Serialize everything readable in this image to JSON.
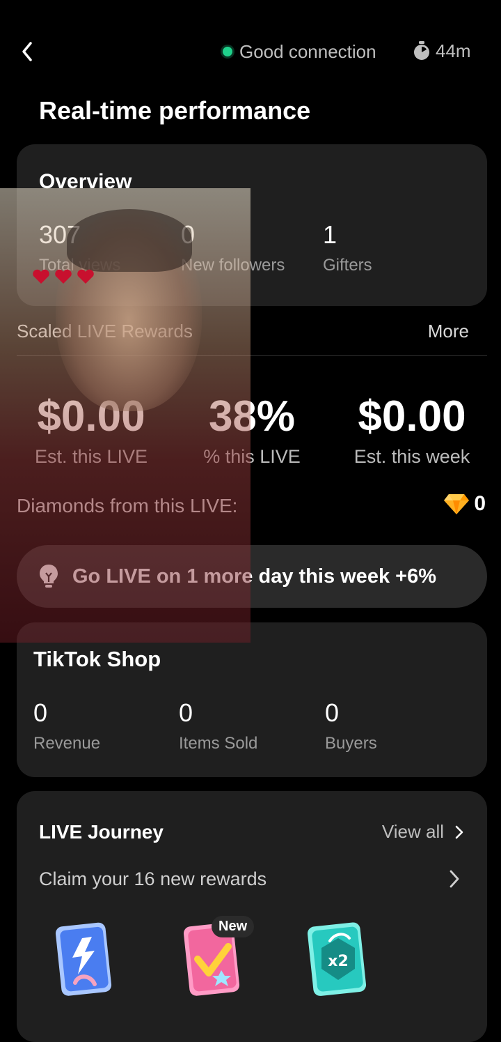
{
  "topbar": {
    "connection_label": "Good connection",
    "timer_label": "44m",
    "connection_color": "#1fd18b"
  },
  "page_title": "Real-time performance",
  "overview": {
    "title": "Overview",
    "stats": [
      {
        "value": "307",
        "label": "Total views"
      },
      {
        "value": "0",
        "label": "New followers"
      },
      {
        "value": "1",
        "label": "Gifters"
      }
    ]
  },
  "rewards": {
    "label": "Scaled LIVE Rewards",
    "more_label": "More",
    "metrics": [
      {
        "value": "$0.00",
        "label": "Est. this LIVE"
      },
      {
        "value": "38%",
        "label": "% this LIVE"
      },
      {
        "value": "$0.00",
        "label": "Est. this week"
      }
    ],
    "diamonds_label": "Diamonds from this LIVE:",
    "diamonds_value": "0"
  },
  "tip": {
    "text": "Go LIVE on 1 more day this week +6%",
    "icon": "lightbulb-icon"
  },
  "shop": {
    "title": "TikTok Shop",
    "stats": [
      {
        "value": "0",
        "label": "Revenue"
      },
      {
        "value": "0",
        "label": "Items Sold"
      },
      {
        "value": "0",
        "label": "Buyers"
      }
    ]
  },
  "journey": {
    "title": "LIVE Journey",
    "view_all_label": "View all",
    "claim_label": "Claim your 16 new rewards",
    "rewards": [
      {
        "icon": "lightning-card-icon",
        "badge": ""
      },
      {
        "icon": "checkmark-card-icon",
        "badge": "New"
      },
      {
        "icon": "x2-boost-card-icon",
        "badge": "",
        "multiplier": "x2"
      }
    ]
  }
}
